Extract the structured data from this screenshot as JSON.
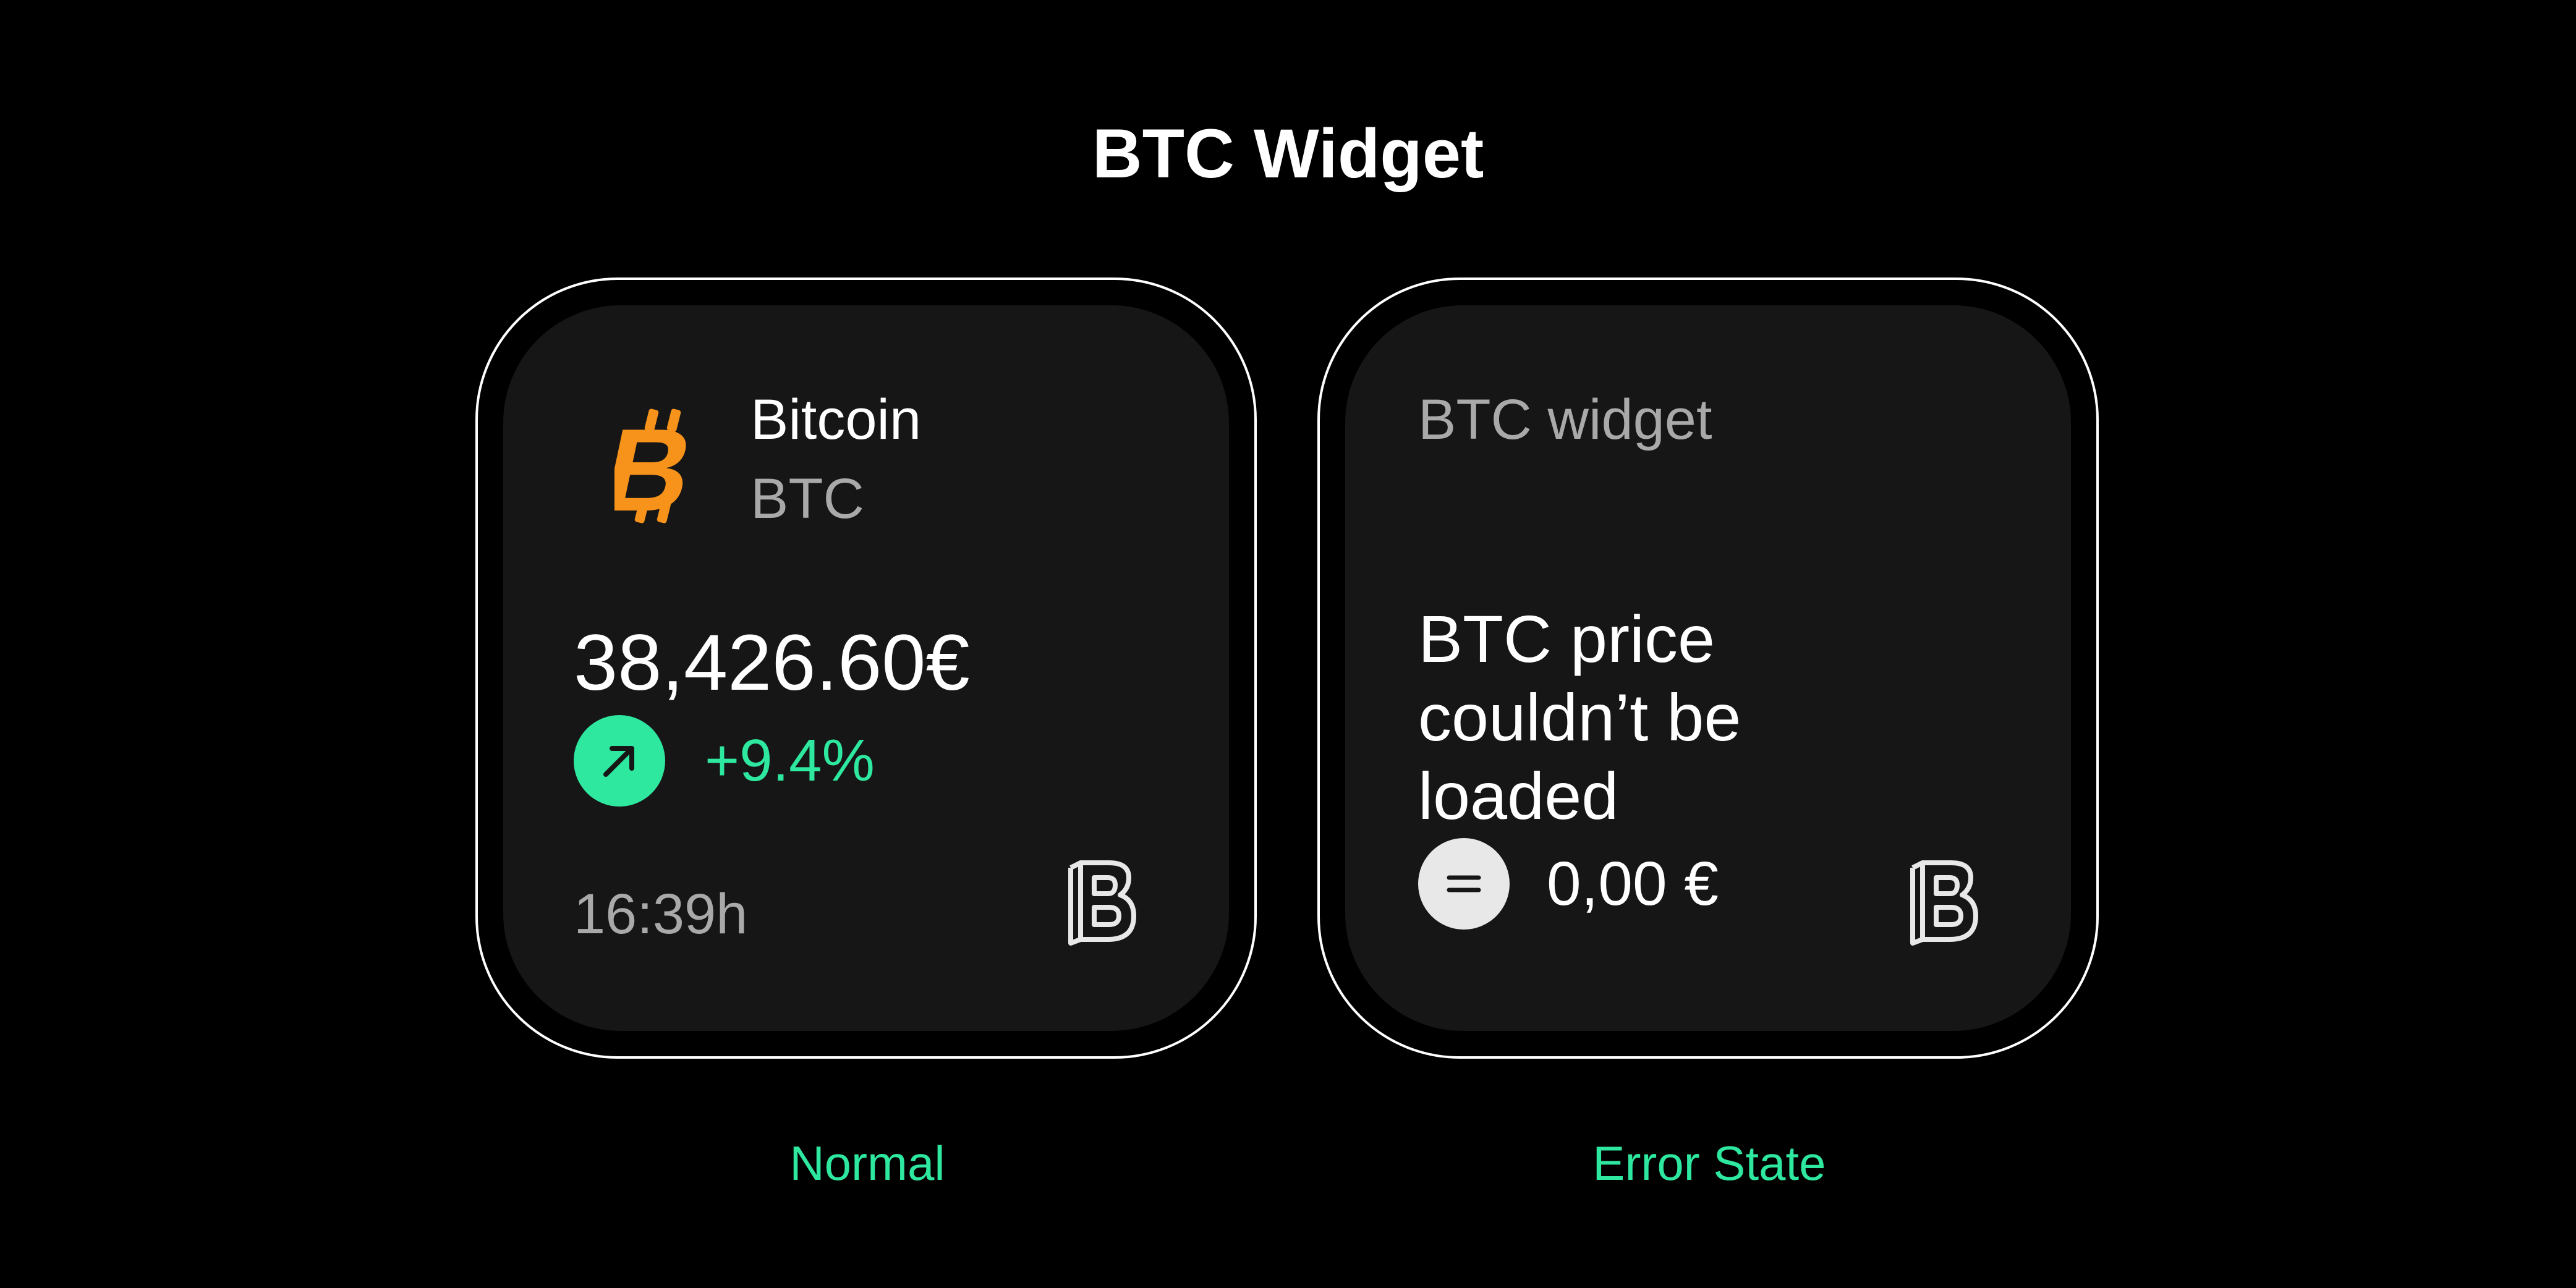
{
  "page": {
    "title": "BTC Widget"
  },
  "widgets": {
    "normal": {
      "coin_name": "Bitcoin",
      "coin_ticker": "BTC",
      "price": "38,426.60€",
      "change": "+9.4%",
      "trend_icon": "arrow-up-right-icon",
      "time": "16:39h",
      "logo_icon": "bitpanda-logo-icon",
      "coin_icon": "bitcoin-icon",
      "caption": "Normal"
    },
    "error": {
      "label": "BTC widget",
      "message_lines": [
        "BTC price",
        "couldn’t be",
        "loaded"
      ],
      "price": "0,00 €",
      "status_icon": "equals-icon",
      "logo_icon": "bitpanda-logo-icon",
      "caption": "Error State"
    }
  },
  "colors": {
    "background": "#000000",
    "card": "#161616",
    "accent_green": "#2ee8a0",
    "bitcoin_orange": "#f7931a",
    "text_primary": "#ffffff",
    "text_secondary": "#a9a9a9"
  }
}
